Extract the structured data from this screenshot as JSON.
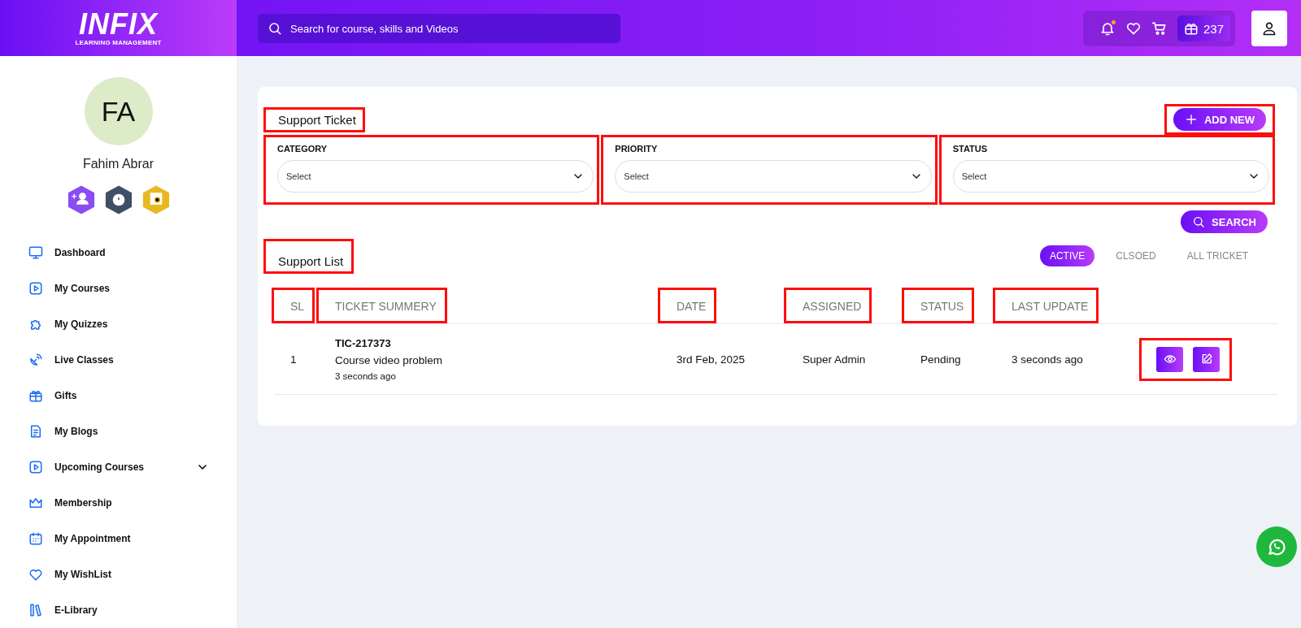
{
  "header": {
    "logo": "INFIX",
    "logo_subtitle": "LEARNING MANAGEMENT",
    "search": {
      "placeholder": "Search for course, skills and Videos"
    },
    "notification_dot": true,
    "points": "237"
  },
  "sidebar": {
    "avatar_initials": "FA",
    "user_name": "Fahim Abrar",
    "items": [
      {
        "label": "Dashboard",
        "expandable": false
      },
      {
        "label": "My Courses",
        "expandable": false
      },
      {
        "label": "My Quizzes",
        "expandable": false
      },
      {
        "label": "Live Classes",
        "expandable": false
      },
      {
        "label": "Gifts",
        "expandable": false
      },
      {
        "label": "My Blogs",
        "expandable": false
      },
      {
        "label": "Upcoming Courses",
        "expandable": true
      },
      {
        "label": "Membership",
        "expandable": false
      },
      {
        "label": "My Appointment",
        "expandable": false
      },
      {
        "label": "My WishList",
        "expandable": false
      },
      {
        "label": "E-Library",
        "expandable": false
      }
    ]
  },
  "ticket": {
    "title": "Support Ticket",
    "title_highlighted": true,
    "add_new": {
      "label": "ADD NEW",
      "highlighted": true
    },
    "filters": [
      {
        "label": "CATEGORY",
        "placeholder": "Select",
        "highlighted": true
      },
      {
        "label": "PRIORITY",
        "placeholder": "Select",
        "highlighted": true
      },
      {
        "label": "STATUS",
        "placeholder": "Select",
        "highlighted": true
      }
    ],
    "search_button": "SEARCH"
  },
  "support_list": {
    "title": "Support List",
    "title_highlighted": true,
    "tabs": [
      {
        "label": "ACTIVE",
        "selected": true
      },
      {
        "label": "CLSOED",
        "selected": false
      },
      {
        "label": "ALL TRICKET",
        "selected": false
      }
    ],
    "columns": [
      {
        "label": "SL",
        "highlighted": true
      },
      {
        "label": "TICKET SUMMERY",
        "highlighted": true
      },
      {
        "label": "DATE",
        "highlighted": true
      },
      {
        "label": "ASSIGNED",
        "highlighted": true
      },
      {
        "label": "STATUS",
        "highlighted": true
      },
      {
        "label": "LAST UPDATE",
        "highlighted": true
      }
    ],
    "rows": [
      {
        "sl": "1",
        "ticket_id": "TIC-217373",
        "summary": "Course video problem",
        "created": "3 seconds ago",
        "date": "3rd Feb, 2025",
        "assigned": "Super Admin",
        "status": "Pending",
        "last_update": "3 seconds ago",
        "actions_highlighted": true
      }
    ]
  }
}
